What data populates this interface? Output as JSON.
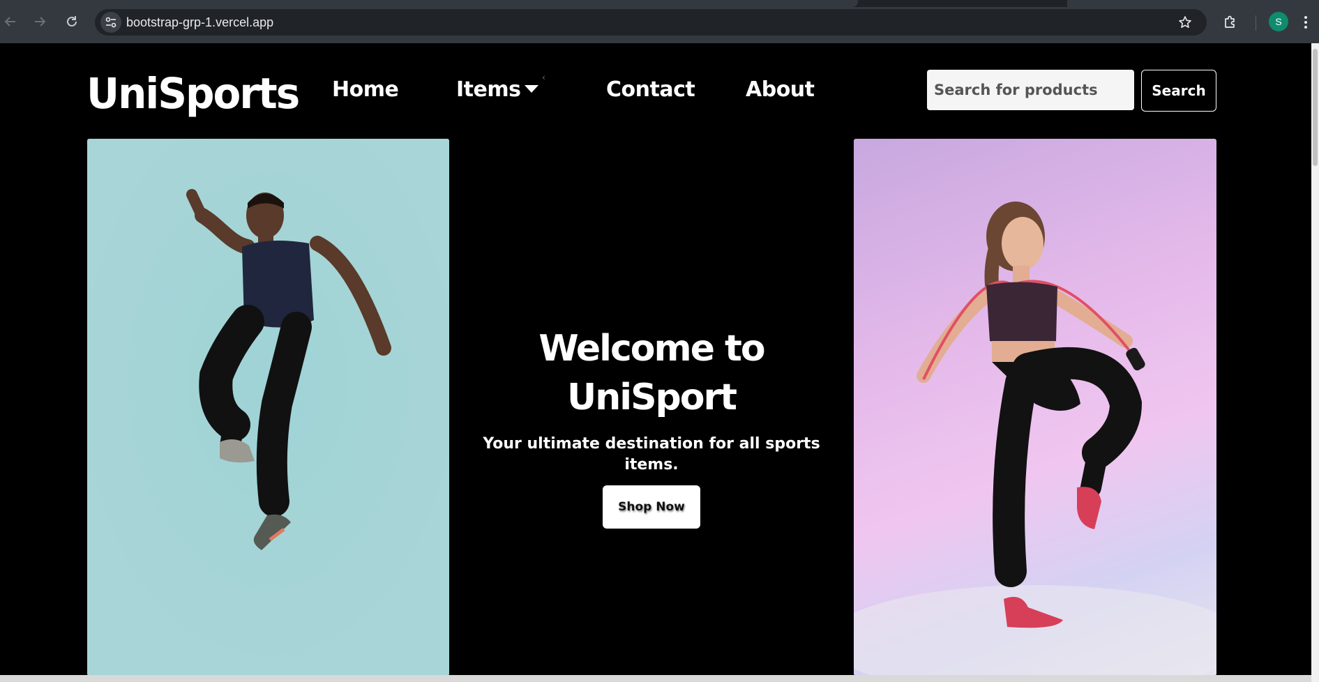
{
  "browser": {
    "url": "bootstrap-grp-1.vercel.app",
    "profile_initial": "S",
    "icons": {
      "back": "arrow-left-icon",
      "forward": "arrow-right-icon",
      "reload": "reload-icon",
      "site_info": "tune-icon",
      "bookmark": "star-icon",
      "extensions": "puzzle-icon",
      "menu": "kebab-icon"
    },
    "colors": {
      "chrome": "#34393f",
      "omnibox": "#202327",
      "avatar": "#0f8b6e"
    }
  },
  "navbar": {
    "brand": "UniSports",
    "links": [
      {
        "label": "Home"
      },
      {
        "label": "Items"
      },
      {
        "label": "Contact"
      },
      {
        "label": "About"
      }
    ],
    "search": {
      "placeholder": "Search for products",
      "button_label": "Search"
    }
  },
  "hero": {
    "title": "Welcome to UniSport",
    "subtitle": "Your ultimate destination for all sports items.",
    "cta_label": "Shop Now",
    "left_image": "photo",
    "right_image": "photo",
    "colors": {
      "background": "#000000",
      "left_panel": "#a8d5d7",
      "right_panel": "#e4b9ea"
    }
  }
}
